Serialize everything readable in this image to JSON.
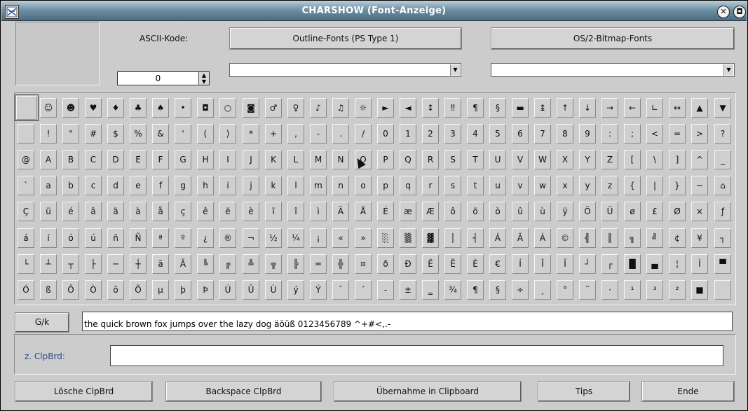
{
  "window": {
    "title": "CHARSHOW (Font-Anzeige)"
  },
  "ascii": {
    "label": "ASCII-Kode:",
    "value": "0"
  },
  "buttons": {
    "outline": "Outline-Fonts (PS Type 1)",
    "bitmap": "OS/2-Bitmap-Fonts",
    "gk": "G/k",
    "loesche": "Lösche ClpBrd",
    "backspace": "Backspace ClpBrd",
    "uebernahme": "Übernahme in Clipboard",
    "tips": "Tips",
    "ende": "Ende"
  },
  "sample_text": "the quick brown fox jumps over the lazy dog  äöüß  0123456789  ^+#<,.-",
  "clipboard": {
    "label": "z. ClpBrd:",
    "value": ""
  },
  "char_rows": [
    [
      "",
      "☺",
      "☻",
      "♥",
      "♦",
      "♣",
      "♠",
      "•",
      "◘",
      "○",
      "◙",
      "♂",
      "♀",
      "♪",
      "♫",
      "☼",
      "►",
      "◄",
      "↕",
      "‼",
      "¶",
      "§",
      "▬",
      "↨",
      "↑",
      "↓",
      "→",
      "←",
      "∟",
      "↔",
      "▲",
      "▼"
    ],
    [
      "",
      "!",
      "\"",
      "#",
      "$",
      "%",
      "&",
      "'",
      "(",
      ")",
      "*",
      "+",
      ",",
      "-",
      ".",
      "/",
      "0",
      "1",
      "2",
      "3",
      "4",
      "5",
      "6",
      "7",
      "8",
      "9",
      ":",
      ";",
      "<",
      "=",
      ">",
      "?"
    ],
    [
      "@",
      "A",
      "B",
      "C",
      "D",
      "E",
      "F",
      "G",
      "H",
      "I",
      "J",
      "K",
      "L",
      "M",
      "N",
      "O",
      "P",
      "Q",
      "R",
      "S",
      "T",
      "U",
      "V",
      "W",
      "X",
      "Y",
      "Z",
      "[",
      "\\",
      "]",
      "^",
      "_"
    ],
    [
      "`",
      "a",
      "b",
      "c",
      "d",
      "e",
      "f",
      "g",
      "h",
      "i",
      "j",
      "k",
      "l",
      "m",
      "n",
      "o",
      "p",
      "q",
      "r",
      "s",
      "t",
      "u",
      "v",
      "w",
      "x",
      "y",
      "z",
      "{",
      "|",
      "}",
      "~",
      "⌂"
    ],
    [
      "Ç",
      "ü",
      "é",
      "â",
      "ä",
      "à",
      "å",
      "ç",
      "ê",
      "ë",
      "è",
      "ï",
      "î",
      "ì",
      "Ä",
      "Å",
      "É",
      "æ",
      "Æ",
      "ô",
      "ö",
      "ò",
      "û",
      "ù",
      "ÿ",
      "Ö",
      "Ü",
      "ø",
      "£",
      "Ø",
      "×",
      "ƒ"
    ],
    [
      "á",
      "í",
      "ó",
      "ú",
      "ñ",
      "Ñ",
      "ª",
      "º",
      "¿",
      "®",
      "¬",
      "½",
      "¼",
      "¡",
      "«",
      "»",
      "░",
      "▒",
      "▓",
      "│",
      "┤",
      "Á",
      "Â",
      "À",
      "©",
      "╣",
      "║",
      "╗",
      "╝",
      "¢",
      "¥",
      "┐"
    ],
    [
      "└",
      "┴",
      "┬",
      "├",
      "─",
      "┼",
      "ã",
      "Ã",
      "╚",
      "╔",
      "╩",
      "╦",
      "╠",
      "═",
      "╬",
      "¤",
      "ð",
      "Ð",
      "Ê",
      "Ë",
      "È",
      "€",
      "Í",
      "Î",
      "Ï",
      "┘",
      "┌",
      "█",
      "▄",
      "¦",
      "Ì",
      "▀"
    ],
    [
      "Ó",
      "ß",
      "Ô",
      "Ò",
      "õ",
      "Õ",
      "µ",
      "þ",
      "Þ",
      "Ú",
      "Û",
      "Ù",
      "ý",
      "Ý",
      "¯",
      "´",
      "-",
      "±",
      "‗",
      "¾",
      "¶",
      "§",
      "÷",
      "¸",
      "°",
      "¨",
      "·",
      "¹",
      "³",
      "²",
      "■",
      ""
    ]
  ]
}
